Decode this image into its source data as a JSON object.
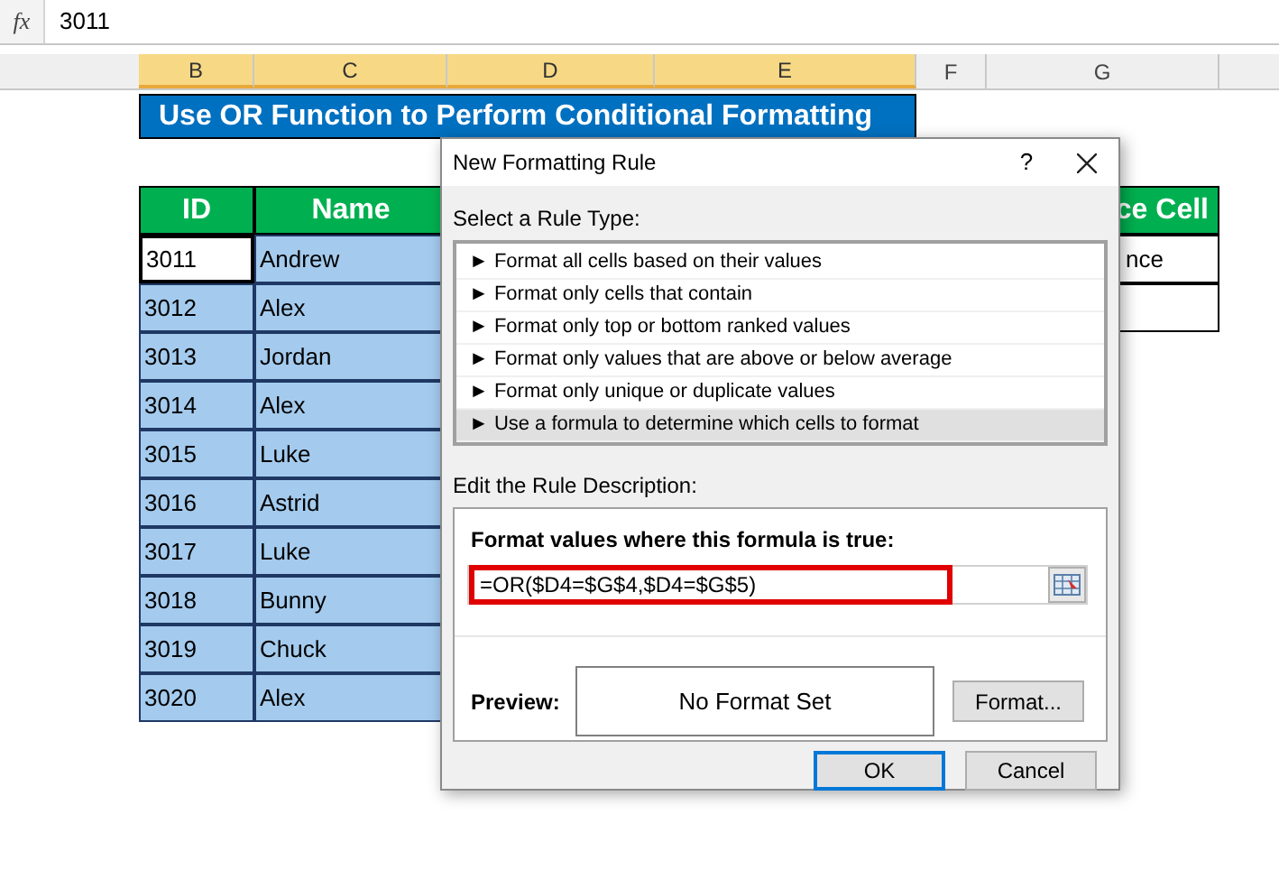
{
  "formula_bar": {
    "function_label": "fx",
    "value": "3011"
  },
  "column_headers": [
    {
      "label": "B",
      "selected": true
    },
    {
      "label": "C",
      "selected": true
    },
    {
      "label": "D",
      "selected": true
    },
    {
      "label": "E",
      "selected": true
    },
    {
      "label": "F",
      "selected": false
    },
    {
      "label": "G",
      "selected": false
    }
  ],
  "sheet_title": "Use OR Function to Perform Conditional Formatting",
  "table": {
    "columns": [
      "ID",
      "Name"
    ],
    "rows": [
      {
        "id": "3011",
        "name": "Andrew",
        "selected": true,
        "active": true
      },
      {
        "id": "3012",
        "name": "Alex",
        "selected": true,
        "active": false
      },
      {
        "id": "3013",
        "name": "Jordan",
        "selected": true,
        "active": false
      },
      {
        "id": "3014",
        "name": "Alex",
        "selected": true,
        "active": false
      },
      {
        "id": "3015",
        "name": "Luke",
        "selected": true,
        "active": false
      },
      {
        "id": "3016",
        "name": "Astrid",
        "selected": true,
        "active": false
      },
      {
        "id": "3017",
        "name": "Luke",
        "selected": true,
        "active": false
      },
      {
        "id": "3018",
        "name": "Bunny",
        "selected": true,
        "active": false
      },
      {
        "id": "3019",
        "name": "Chuck",
        "selected": true,
        "active": false
      },
      {
        "id": "3020",
        "name": "Alex",
        "selected": true,
        "active": false
      }
    ]
  },
  "reference_table": {
    "header": "ce Cell",
    "cells": [
      "nce",
      ""
    ]
  },
  "dialog": {
    "title": "New Formatting Rule",
    "help": "?",
    "rule_type_label": "Select a Rule Type:",
    "rule_types": [
      {
        "label": "► Format all cells based on their values",
        "selected": false
      },
      {
        "label": "► Format only cells that contain",
        "selected": false
      },
      {
        "label": "► Format only top or bottom ranked values",
        "selected": false
      },
      {
        "label": "► Format only values that are above or below average",
        "selected": false
      },
      {
        "label": "► Format only unique or duplicate values",
        "selected": false
      },
      {
        "label": "► Use a formula to determine which cells to format",
        "selected": true
      }
    ],
    "description_label": "Edit the Rule Description:",
    "formula_label": "Format values where this formula is true:",
    "formula": "=OR($D4=$G$4,$D4=$G$5)",
    "preview_label": "Preview:",
    "preview_text": "No Format Set",
    "format_button": "Format...",
    "buttons": [
      {
        "label": "OK",
        "selected": true
      },
      {
        "label": "Cancel",
        "selected": false
      }
    ]
  }
}
